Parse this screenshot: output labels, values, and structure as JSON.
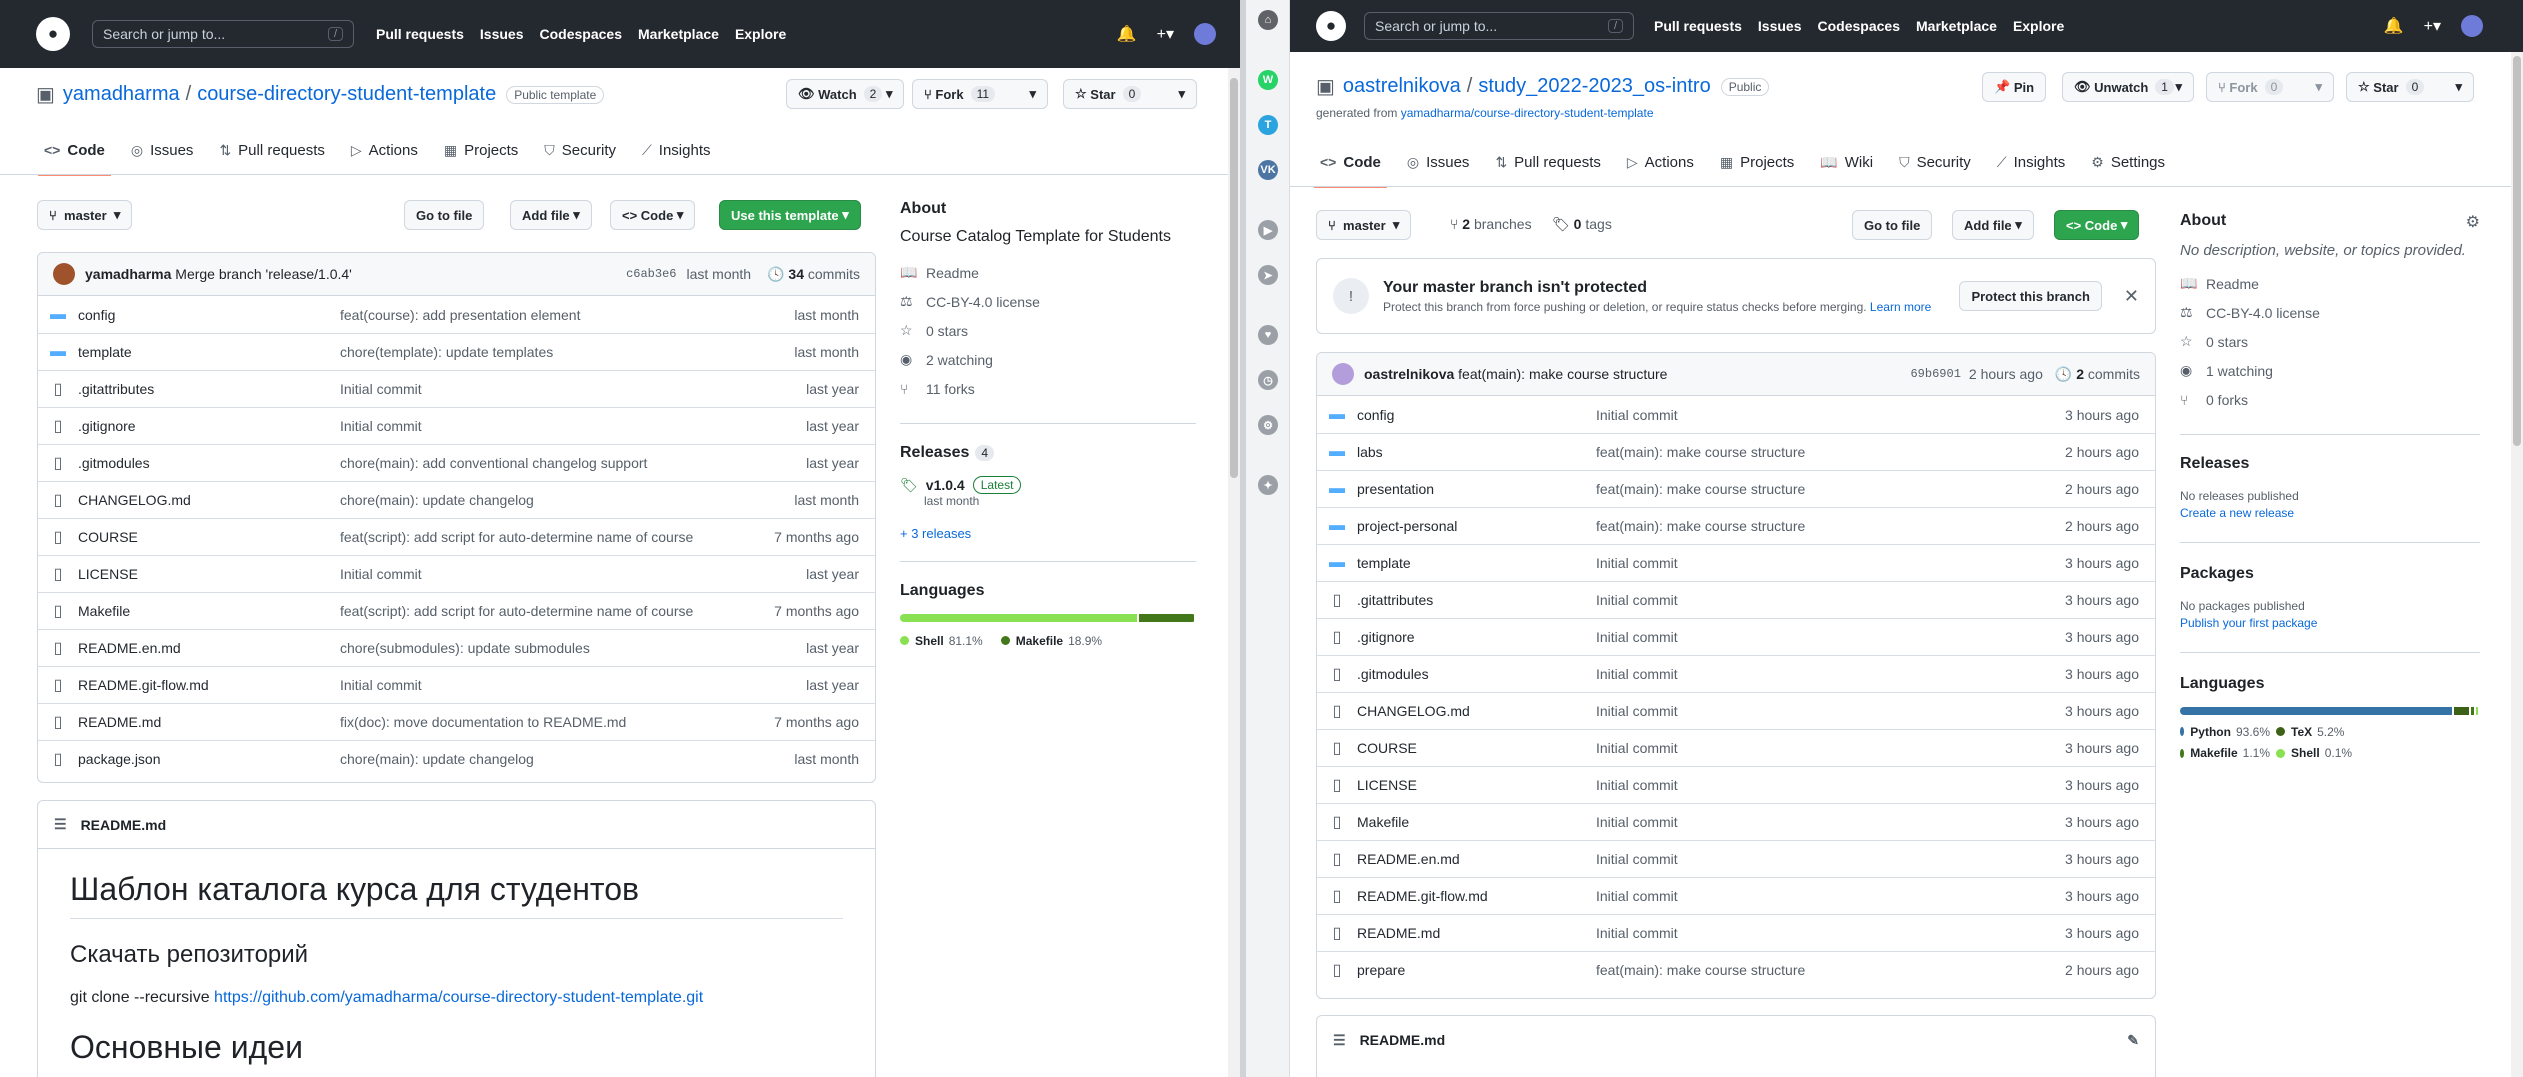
{
  "colors": {
    "accent": "#0969da",
    "green": "#2da44e",
    "header": "#24292f",
    "shell": "#89e051",
    "makefile": "#427819",
    "python": "#3572A5",
    "tex": "#3D6117"
  },
  "left": {
    "header": {
      "search": "Search or jump to...",
      "slash": "/",
      "nav": [
        "Pull requests",
        "Issues",
        "Codespaces",
        "Marketplace",
        "Explore"
      ]
    },
    "repo": {
      "owner": "yamadharma",
      "sep": "/",
      "name": "course-directory-student-template",
      "badge": "Public template"
    },
    "actions": {
      "watch": "Watch",
      "watch_count": "2",
      "fork": "Fork",
      "fork_count": "11",
      "star": "Star",
      "star_count": "0"
    },
    "tabs": [
      "Code",
      "Issues",
      "Pull requests",
      "Actions",
      "Projects",
      "Security",
      "Insights"
    ],
    "toolbar": {
      "branch": "master",
      "goto": "Go to file",
      "add": "Add file",
      "code": "Code",
      "template": "Use this template"
    },
    "commit": {
      "author": "yamadharma",
      "message": "Merge branch 'release/1.0.4'",
      "hash": "c6ab3e6",
      "time": "last month",
      "count": "34",
      "count_label": "commits"
    },
    "files": [
      {
        "name": "config",
        "type": "dir",
        "msg": "feat(course): add presentation element",
        "time": "last month"
      },
      {
        "name": "template",
        "type": "dir",
        "msg": "chore(template): update templates",
        "time": "last month"
      },
      {
        "name": ".gitattributes",
        "type": "file",
        "msg": "Initial commit",
        "time": "last year"
      },
      {
        "name": ".gitignore",
        "type": "file",
        "msg": "Initial commit",
        "time": "last year"
      },
      {
        "name": ".gitmodules",
        "type": "file",
        "msg": "chore(main): add conventional changelog support",
        "time": "last year"
      },
      {
        "name": "CHANGELOG.md",
        "type": "file",
        "msg": "chore(main): update changelog",
        "time": "last month"
      },
      {
        "name": "COURSE",
        "type": "file",
        "msg": "feat(script): add script for auto-determine name of course",
        "time": "7 months ago"
      },
      {
        "name": "LICENSE",
        "type": "file",
        "msg": "Initial commit",
        "time": "last year"
      },
      {
        "name": "Makefile",
        "type": "file",
        "msg": "feat(script): add script for auto-determine name of course",
        "time": "7 months ago"
      },
      {
        "name": "README.en.md",
        "type": "file",
        "msg": "chore(submodules): update submodules",
        "time": "last year"
      },
      {
        "name": "README.git-flow.md",
        "type": "file",
        "msg": "Initial commit",
        "time": "last year"
      },
      {
        "name": "README.md",
        "type": "file",
        "msg": "fix(doc): move documentation to README.md",
        "time": "7 months ago"
      },
      {
        "name": "package.json",
        "type": "file",
        "msg": "chore(main): update changelog",
        "time": "last month"
      }
    ],
    "readme": {
      "filename": "README.md",
      "h1": "Шаблон каталога курса для студентов",
      "h2": "Скачать репозиторий",
      "code": "git clone --recursive ",
      "link": "https://github.com/yamadharma/course-directory-student-template.git",
      "h1b": "Основные идеи"
    },
    "about": {
      "title": "About",
      "desc": "Course Catalog Template for Students",
      "readme": "Readme",
      "license": "CC-BY-4.0 license",
      "stars": "0 stars",
      "watching": "2 watching",
      "forks": "11 forks"
    },
    "releases": {
      "title": "Releases",
      "count": "4",
      "version": "v1.0.4",
      "latest": "Latest",
      "when": "last month",
      "more": "+ 3 releases"
    },
    "languages": {
      "title": "Languages",
      "items": [
        {
          "name": "Shell",
          "pct": "81.1%",
          "value": 81.1
        },
        {
          "name": "Makefile",
          "pct": "18.9%",
          "value": 18.9
        }
      ]
    }
  },
  "right": {
    "header": {
      "search": "Search or jump to...",
      "slash": "/",
      "nav": [
        "Pull requests",
        "Issues",
        "Codespaces",
        "Marketplace",
        "Explore"
      ]
    },
    "repo": {
      "owner": "oastrelnikova",
      "sep": "/",
      "name": "study_2022-2023_os-intro",
      "badge": "Public",
      "generated_prefix": "generated from ",
      "generated_link": "yamadharma/course-directory-student-template"
    },
    "actions": {
      "pin": "Pin",
      "unwatch": "Unwatch",
      "watch_count": "1",
      "fork": "Fork",
      "fork_count": "0",
      "star": "Star",
      "star_count": "0"
    },
    "tabs": [
      "Code",
      "Issues",
      "Pull requests",
      "Actions",
      "Projects",
      "Wiki",
      "Security",
      "Insights",
      "Settings"
    ],
    "toolbar": {
      "branch": "master",
      "branches_count": "2",
      "branches_label": "branches",
      "tags_count": "0",
      "tags_label": "tags",
      "goto": "Go to file",
      "add": "Add file",
      "code": "Code"
    },
    "protect": {
      "title": "Your master branch isn't protected",
      "desc": "Protect this branch from force pushing or deletion, or require status checks before merging.",
      "learn": "Learn more",
      "button": "Protect this branch"
    },
    "commit": {
      "author": "oastrelnikova",
      "message": "feat(main): make course structure",
      "hash": "69b6901",
      "time": "2 hours ago",
      "count": "2",
      "count_label": "commits"
    },
    "files": [
      {
        "name": "config",
        "type": "dir",
        "msg": "Initial commit",
        "time": "3 hours ago"
      },
      {
        "name": "labs",
        "type": "dir",
        "msg": "feat(main): make course structure",
        "time": "2 hours ago"
      },
      {
        "name": "presentation",
        "type": "dir",
        "msg": "feat(main): make course structure",
        "time": "2 hours ago"
      },
      {
        "name": "project-personal",
        "type": "dir",
        "msg": "feat(main): make course structure",
        "time": "2 hours ago"
      },
      {
        "name": "template",
        "type": "dir",
        "msg": "Initial commit",
        "time": "3 hours ago"
      },
      {
        "name": ".gitattributes",
        "type": "file",
        "msg": "Initial commit",
        "time": "3 hours ago"
      },
      {
        "name": ".gitignore",
        "type": "file",
        "msg": "Initial commit",
        "time": "3 hours ago"
      },
      {
        "name": ".gitmodules",
        "type": "file",
        "msg": "Initial commit",
        "time": "3 hours ago"
      },
      {
        "name": "CHANGELOG.md",
        "type": "file",
        "msg": "Initial commit",
        "time": "3 hours ago"
      },
      {
        "name": "COURSE",
        "type": "file",
        "msg": "Initial commit",
        "time": "3 hours ago"
      },
      {
        "name": "LICENSE",
        "type": "file",
        "msg": "Initial commit",
        "time": "3 hours ago"
      },
      {
        "name": "Makefile",
        "type": "file",
        "msg": "Initial commit",
        "time": "3 hours ago"
      },
      {
        "name": "README.en.md",
        "type": "file",
        "msg": "Initial commit",
        "time": "3 hours ago"
      },
      {
        "name": "README.git-flow.md",
        "type": "file",
        "msg": "Initial commit",
        "time": "3 hours ago"
      },
      {
        "name": "README.md",
        "type": "file",
        "msg": "Initial commit",
        "time": "3 hours ago"
      },
      {
        "name": "prepare",
        "type": "file",
        "msg": "feat(main): make course structure",
        "time": "2 hours ago"
      }
    ],
    "readme": {
      "filename": "README.md"
    },
    "about": {
      "title": "About",
      "desc": "No description, website, or topics provided.",
      "readme": "Readme",
      "license": "CC-BY-4.0 license",
      "stars": "0 stars",
      "watching": "1 watching",
      "forks": "0 forks"
    },
    "releases": {
      "title": "Releases",
      "none": "No releases published",
      "create": "Create a new release"
    },
    "packages": {
      "title": "Packages",
      "none": "No packages published",
      "publish": "Publish your first package"
    },
    "languages": {
      "title": "Languages",
      "items": [
        {
          "name": "Python",
          "pct": "93.6%",
          "value": 93.6
        },
        {
          "name": "TeX",
          "pct": "5.2%",
          "value": 5.2
        },
        {
          "name": "Makefile",
          "pct": "1.1%",
          "value": 1.1
        },
        {
          "name": "Shell",
          "pct": "0.1%",
          "value": 0.1
        }
      ]
    }
  }
}
